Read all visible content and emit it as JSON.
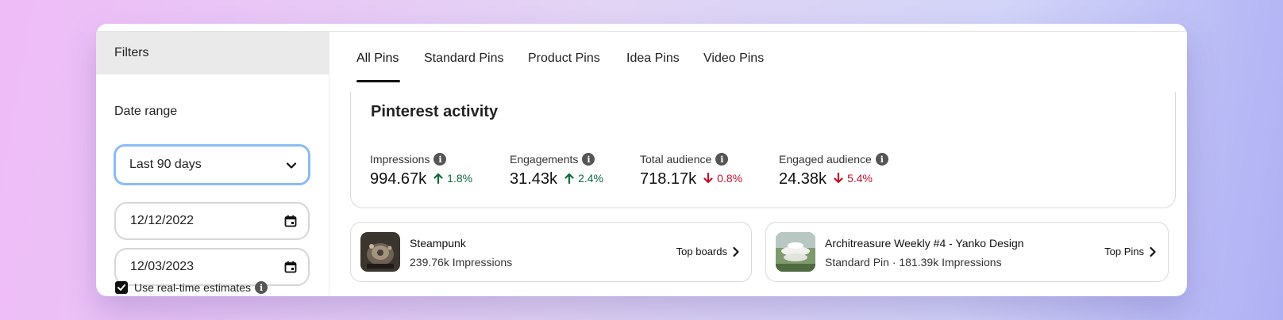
{
  "sidebar": {
    "filters_title": "Filters",
    "date_range_label": "Date range",
    "date_range_selected": "Last 90 days",
    "start_date": "12/12/2022",
    "end_date": "12/03/2023",
    "realtime_label": "Use real-time estimates",
    "realtime_checked": true
  },
  "tabs": [
    {
      "label": "All Pins",
      "active": true
    },
    {
      "label": "Standard Pins"
    },
    {
      "label": "Product Pins"
    },
    {
      "label": "Idea Pins"
    },
    {
      "label": "Video Pins"
    }
  ],
  "activity": {
    "title": "Pinterest activity",
    "metrics": [
      {
        "label": "Impressions",
        "value": "994.67k",
        "change": "1.8%",
        "direction": "up"
      },
      {
        "label": "Engagements",
        "value": "31.43k",
        "change": "2.4%",
        "direction": "up"
      },
      {
        "label": "Total audience",
        "value": "718.17k",
        "change": "0.8%",
        "direction": "down"
      },
      {
        "label": "Engaged audience",
        "value": "24.38k",
        "change": "5.4%",
        "direction": "down"
      }
    ]
  },
  "top_cards": [
    {
      "title": "Steampunk",
      "subtitle": "239.76k Impressions",
      "link": "Top boards"
    },
    {
      "title": "Architreasure Weekly #4 - Yanko Design",
      "subtitle": "Standard Pin · 181.39k Impressions",
      "link": "Top Pins"
    }
  ],
  "colors": {
    "up": "#0b6b3a",
    "down": "#c8102e",
    "focus_ring": "#8bbcf5"
  },
  "icons": [
    "chevron-down-icon",
    "calendar-icon",
    "info-icon",
    "arrow-up-icon",
    "arrow-down-icon",
    "chevron-right-icon",
    "checkmark-icon"
  ]
}
